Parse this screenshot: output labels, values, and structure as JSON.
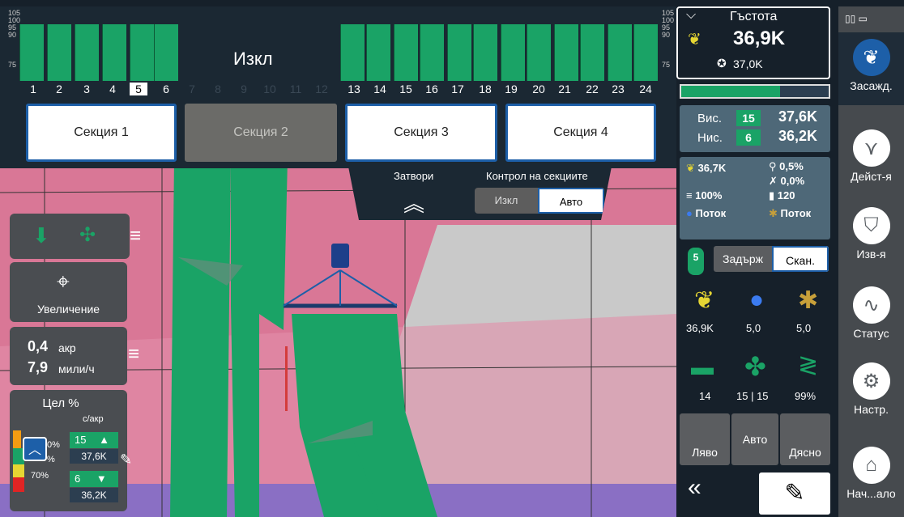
{
  "top": {
    "status": "Изкл",
    "scale_left": [
      "105",
      "100",
      "95",
      "90",
      "75"
    ],
    "scale_right": [
      "105",
      "100",
      "95",
      "90",
      "75"
    ],
    "row_numbers": [
      "1",
      "2",
      "3",
      "4",
      "5",
      "6",
      "7",
      "8",
      "9",
      "10",
      "11",
      "12",
      "13",
      "14",
      "15",
      "16",
      "17",
      "18",
      "19",
      "20",
      "21",
      "22",
      "23",
      "24"
    ],
    "selected_row": "5",
    "sections": [
      "Секция 1",
      "Секция 2",
      "Секция 3",
      "Секция 4"
    ]
  },
  "shutters": {
    "label": "Затвори",
    "control_label": "Контрол на секциите",
    "off": "Изкл",
    "auto": "Авто"
  },
  "left": {
    "zoom_label": "Увеличение",
    "area_value": "0,4",
    "area_unit": "акр",
    "speed_value": "7,9",
    "speed_unit": "мили/ч",
    "target_title": "Цел %",
    "target_unit": "с/акр",
    "high_value": "15",
    "high_pop": "37,6K",
    "low_value": "6",
    "low_pop": "36,2K",
    "pct_top": "0%",
    "pct_mid": "%",
    "pct_bottom": "70%"
  },
  "right": {
    "density_title": "Гъстота",
    "density_value": "36,9K",
    "density_target": "37,0K",
    "high_label": "Вис.",
    "high_row": "15",
    "high_value": "37,6K",
    "low_label": "Нис.",
    "low_row": "6",
    "low_value": "36,2K",
    "pop": "36,7K",
    "skips": "0,5%",
    "doubles": "0,0%",
    "singulation": "100%",
    "count": "120",
    "flow1": "Поток",
    "flow2": "Поток",
    "badge": "5",
    "hold": "Задърж",
    "scan": "Скан.",
    "seed_value": "36,9K",
    "drop_value": "5,0",
    "insect_value": "5,0",
    "hopper_value": "14",
    "fan_value_a": "15",
    "fan_value_b": "15",
    "spring_value": "99%",
    "left_label": "Ляво",
    "auto_label": "Авто",
    "right_label": "Дясно"
  },
  "nav": {
    "items": [
      "Засажд.",
      "Дейст-я",
      "Изв-я",
      "Статус",
      "Настр.",
      "Нач...ало"
    ]
  }
}
